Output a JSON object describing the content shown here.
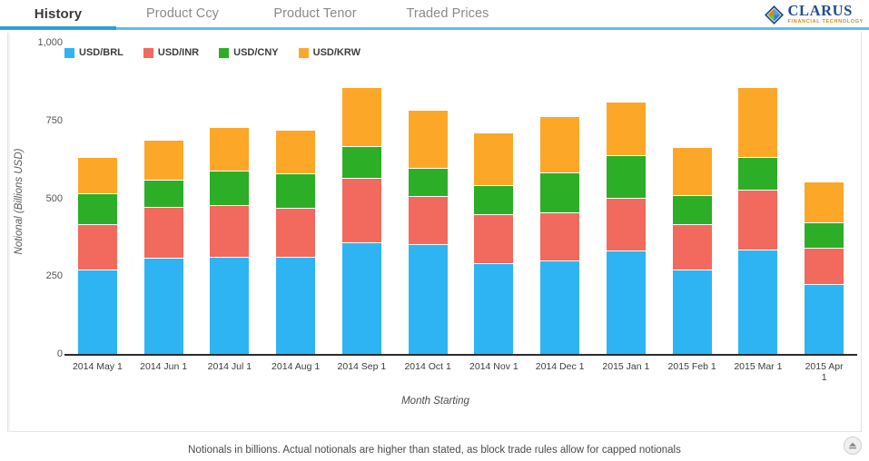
{
  "nav": {
    "tabs": [
      {
        "label": "History",
        "active": true
      },
      {
        "label": "Product Ccy",
        "active": false
      },
      {
        "label": "Product Tenor",
        "active": false
      },
      {
        "label": "Traded Prices",
        "active": false
      }
    ]
  },
  "brand": {
    "name": "CLARUS",
    "tagline": "FINANCIAL TECHNOLOGY",
    "icon": "clarus-diamond-icon",
    "color_primary": "#1f4e8c",
    "color_accent": "#e2820f"
  },
  "footer": {
    "note": "Notionals in billions. Actual notionals are higher than stated, as block trade rules allow for capped notionals",
    "scroll_top_icon": "scroll-to-top-icon"
  },
  "chart_data": {
    "type": "bar",
    "stacked": true,
    "title": "",
    "xlabel": "Month Starting",
    "ylabel": "Notional (Billions USD)",
    "ylim": [
      0,
      1000
    ],
    "yticks": [
      0,
      250,
      500,
      750,
      1000
    ],
    "ytick_labels": [
      "0",
      "250",
      "500",
      "750",
      "1,000"
    ],
    "grid": false,
    "legend_position": "top-left",
    "categories": [
      "2014 May 1",
      "2014 Jun 1",
      "2014 Jul 1",
      "2014 Aug 1",
      "2014 Sep 1",
      "2014 Oct 1",
      "2014 Nov 1",
      "2014 Dec 1",
      "2015 Jan 1",
      "2015 Feb 1",
      "2015 Mar 1",
      "2015 Apr 1"
    ],
    "series": [
      {
        "name": "USD/BRL",
        "color": "#2eb4f2",
        "values": [
          271,
          309,
          312,
          312,
          359,
          353,
          292,
          300,
          332,
          271,
          335,
          224
        ]
      },
      {
        "name": "USD/INR",
        "color": "#f2695d",
        "values": [
          146,
          163,
          166,
          157,
          207,
          155,
          157,
          155,
          169,
          146,
          192,
          117
        ]
      },
      {
        "name": "USD/CNY",
        "color": "#2cae26",
        "values": [
          99,
          88,
          111,
          111,
          102,
          90,
          93,
          128,
          137,
          93,
          105,
          82
        ]
      },
      {
        "name": "USD/KRW",
        "color": "#fca728",
        "values": [
          117,
          128,
          140,
          140,
          190,
          187,
          169,
          181,
          172,
          155,
          225,
          131
        ]
      }
    ]
  }
}
